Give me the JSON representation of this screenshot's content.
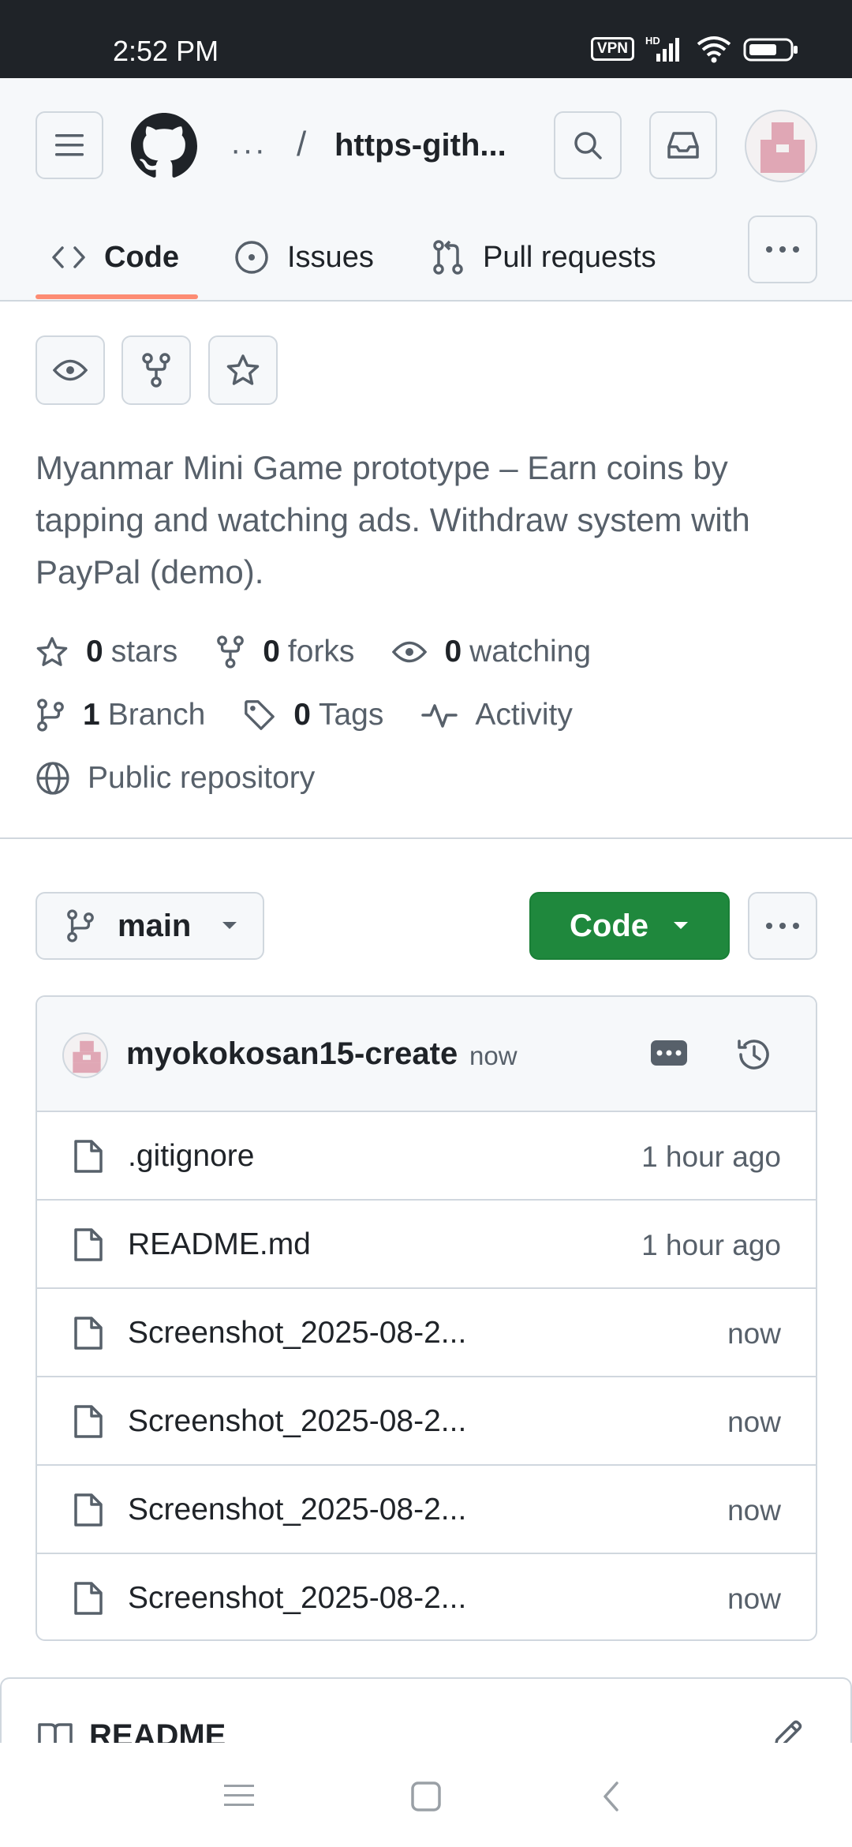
{
  "status_bar": {
    "time": "2:52 PM",
    "vpn": "VPN",
    "hd": "HD"
  },
  "header": {
    "breadcrumb_dots": "···",
    "breadcrumb_separator": "/",
    "repo_name": "https-gith..."
  },
  "tabs": [
    {
      "label": "Code",
      "active": true
    },
    {
      "label": "Issues",
      "active": false
    },
    {
      "label": "Pull requests",
      "active": false
    }
  ],
  "repo": {
    "description": "Myanmar Mini Game prototype – Earn coins by tapping and watching ads. Withdraw system with PayPal (demo).",
    "stars_count": "0",
    "stars_label": "stars",
    "forks_count": "0",
    "forks_label": "forks",
    "watching_count": "0",
    "watching_label": "watching",
    "branch_count": "1",
    "branch_label": "Branch",
    "tags_count": "0",
    "tags_label": "Tags",
    "activity_label": "Activity",
    "visibility": "Public repository"
  },
  "toolbar": {
    "branch": "main",
    "code_label": "Code"
  },
  "commit": {
    "author": "myokokosan15-create",
    "time": "now"
  },
  "files": [
    {
      "name": ".gitignore",
      "time": "1 hour ago"
    },
    {
      "name": "README.md",
      "time": "1 hour ago"
    },
    {
      "name": "Screenshot_2025-08-2...",
      "time": "now"
    },
    {
      "name": "Screenshot_2025-08-2...",
      "time": "now"
    },
    {
      "name": "Screenshot_2025-08-2...",
      "time": "now"
    },
    {
      "name": "Screenshot_2025-08-2...",
      "time": "now"
    }
  ],
  "readme": {
    "title": "README"
  },
  "colors": {
    "accent_green": "#1f883d",
    "tab_underline": "#fd8c73",
    "muted": "#57606a"
  }
}
